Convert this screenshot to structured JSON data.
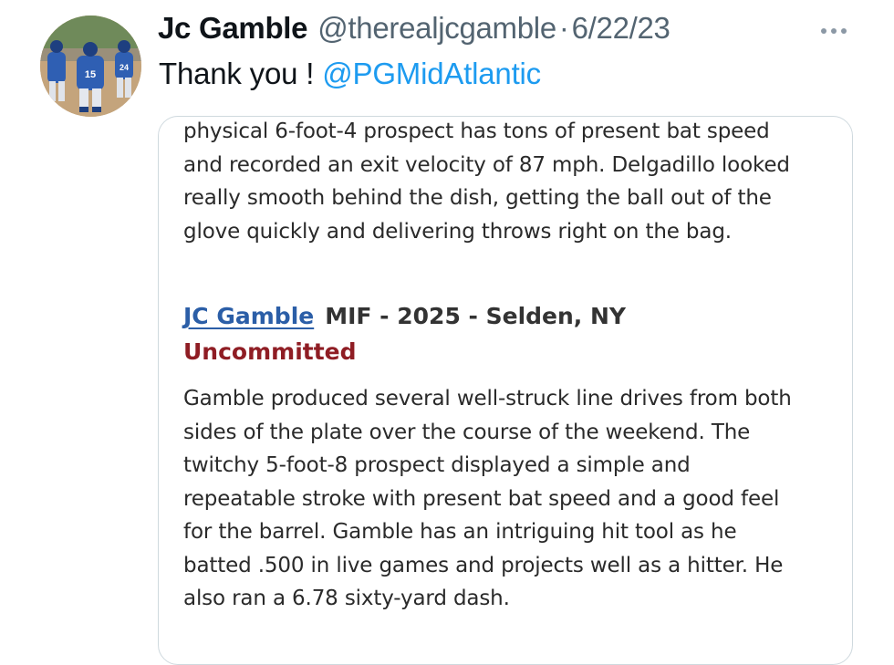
{
  "tweet": {
    "author_name": "Jc Gamble",
    "author_handle": "@therealjcgamble",
    "separator": "·",
    "date": "6/22/23",
    "text_prefix": "Thank you ! ",
    "mention": "@PGMidAtlantic"
  },
  "avatar": {
    "jersey_numbers": [
      "15",
      "24"
    ]
  },
  "embedded_article": {
    "intro_lines": [
      "physical 6-foot-4 prospect has tons of present bat speed",
      "and recorded an exit velocity of 87 mph. Delgadillo looked",
      "really smooth behind the dish, getting the ball out of the",
      "glove quickly and delivering throws right on the bag."
    ],
    "player": {
      "name": "JC Gamble",
      "meta": "MIF - 2025 - Selden, NY",
      "commitment": "Uncommitted"
    },
    "report_lines": [
      "Gamble produced several well-struck line drives from both",
      "sides of the plate over the course of the weekend. The",
      "twitchy 5-foot-8 prospect displayed a simple and",
      "repeatable stroke with present bat speed and a good feel",
      "for the barrel. Gamble has an intriguing hit tool as he",
      "batted .500 in live games and projects well as a hitter. He",
      "also ran a 6.78 sixty-yard dash."
    ]
  },
  "colors": {
    "link_blue": "#1d9bf0",
    "player_link": "#2b5ea7",
    "commitment_red": "#8f1d24",
    "secondary_text": "#536471",
    "card_border": "#cfd9de"
  }
}
